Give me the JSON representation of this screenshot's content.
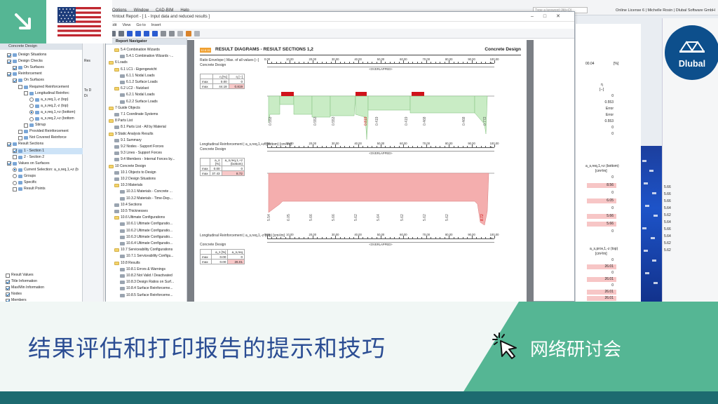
{
  "app": {
    "menu": [
      "Options",
      "Window",
      "CAD-BIM",
      "Help"
    ],
    "search_placeholder": "Type a keyword (Alt+Q)",
    "license_info": "Online License 6 | Michelle Rosin | Dlubal Software GmbH"
  },
  "left_panel": {
    "title": "Concrete Design",
    "rows": [
      {
        "label": "Design Situations",
        "checked": true
      },
      {
        "label": "Design Checks",
        "checked": true
      },
      {
        "label": "On Surfaces",
        "checked": true
      },
      {
        "label": "Reinforcement",
        "checked": true
      },
      {
        "label": "On Surfaces",
        "checked": true
      },
      {
        "label": "Required Reinforcement",
        "checked": false
      },
      {
        "label": "Longitudinal Reinforc",
        "checked": false
      },
      {
        "label": "a_s,req,1,-z (top)",
        "radio": false
      },
      {
        "label": "a_s,req,2,-z (top)",
        "radio": false
      },
      {
        "label": "a_s,req,1,+z (bottom)",
        "radio": true
      },
      {
        "label": "a_s,req,2,+z (bottom",
        "radio": false
      },
      {
        "label": "Stirrup",
        "checked": false
      },
      {
        "label": "Provided Reinforcement",
        "checked": false
      },
      {
        "label": "Not Covered Reinforce",
        "checked": false
      },
      {
        "label": "Result Sections",
        "checked": true
      },
      {
        "label": "1 - Section 1",
        "checked": true,
        "selected": true
      },
      {
        "label": "2 - Section 2",
        "checked": false
      },
      {
        "label": "Values on Surfaces",
        "checked": true
      },
      {
        "label": "Current Selection: a_s,req,1,+z (b",
        "radio": true
      },
      {
        "label": "Groups",
        "radio": false
      },
      {
        "label": "Specific",
        "radio": false
      },
      {
        "label": "Result Points",
        "checked": false
      }
    ],
    "bottom_rows": [
      {
        "label": "Result Values",
        "checked": false
      },
      {
        "label": "Title Information",
        "checked": true
      },
      {
        "label": "Max/Min Information",
        "checked": true
      },
      {
        "label": "Nodes",
        "checked": true
      },
      {
        "label": "Members",
        "checked": true
      }
    ]
  },
  "mini_tabs": [
    "Co",
    "Res",
    "To D",
    "Di"
  ],
  "report_window": {
    "title": "Printout Report - [ 1 - Input data and reduced results ]",
    "menu": [
      "Edit",
      "View",
      "Go to",
      "Insert"
    ],
    "navigator_title": "Report Navigator",
    "nav_items": [
      {
        "label": "5.4 Combination Wizards",
        "type": "folder",
        "indent": 1
      },
      {
        "label": "5.4.1 Combination Wizards -...",
        "type": "page",
        "indent": 2
      },
      {
        "label": "6 Loads",
        "type": "folder",
        "indent": 0
      },
      {
        "label": "6.1 LC1 - Eigengewicht",
        "type": "folder",
        "indent": 1
      },
      {
        "label": "6.1.1 Nodal Loads",
        "type": "page",
        "indent": 2
      },
      {
        "label": "6.1.2 Surface Loads",
        "type": "page",
        "indent": 2
      },
      {
        "label": "6.2 LC2 - Nutzlast",
        "type": "folder",
        "indent": 1
      },
      {
        "label": "6.2.1 Nodal Loads",
        "type": "page",
        "indent": 2
      },
      {
        "label": "6.2.2 Surface Loads",
        "type": "page",
        "indent": 2
      },
      {
        "label": "7 Guide Objects",
        "type": "folder",
        "indent": 0
      },
      {
        "label": "7.1 Coordinate Systems",
        "type": "page",
        "indent": 1
      },
      {
        "label": "8 Parts List",
        "type": "folder",
        "indent": 0
      },
      {
        "label": "8.1 Parts List - All by Material",
        "type": "page",
        "indent": 1
      },
      {
        "label": "9 Static Analysis Results",
        "type": "folder",
        "indent": 0
      },
      {
        "label": "9.1 Summary",
        "type": "page",
        "indent": 1
      },
      {
        "label": "9.2 Nodes - Support Forces",
        "type": "page",
        "indent": 1
      },
      {
        "label": "9.3 Lines - Support Forces",
        "type": "page",
        "indent": 1
      },
      {
        "label": "9.4 Members - Internal Forces by...",
        "type": "page",
        "indent": 1
      },
      {
        "label": "10 Concrete Design",
        "type": "folder",
        "indent": 0
      },
      {
        "label": "10.1 Objects to Design",
        "type": "page",
        "indent": 1
      },
      {
        "label": "10.2 Design Situations",
        "type": "page",
        "indent": 1
      },
      {
        "label": "10.3 Materials",
        "type": "folder",
        "indent": 1
      },
      {
        "label": "10.3.1 Materials - Concrete ...",
        "type": "page",
        "indent": 2
      },
      {
        "label": "10.3.2 Materials - Time-Dep...",
        "type": "page",
        "indent": 2
      },
      {
        "label": "10.4 Sections",
        "type": "page",
        "indent": 1
      },
      {
        "label": "10.5 Thicknesses",
        "type": "page",
        "indent": 1
      },
      {
        "label": "10.6 Ultimate Configurations",
        "type": "folder",
        "indent": 1
      },
      {
        "label": "10.6.1 Ultimate Configuratio...",
        "type": "page",
        "indent": 2
      },
      {
        "label": "10.6.2 Ultimate Configuratio...",
        "type": "page",
        "indent": 2
      },
      {
        "label": "10.6.3 Ultimate Configuratio...",
        "type": "page",
        "indent": 2
      },
      {
        "label": "10.6.4 Ultimate Configuratio...",
        "type": "page",
        "indent": 2
      },
      {
        "label": "10.7 Serviceability Configurations",
        "type": "folder",
        "indent": 1
      },
      {
        "label": "10.7.1 Serviceability Configu...",
        "type": "page",
        "indent": 2
      },
      {
        "label": "10.8 Results",
        "type": "folder",
        "indent": 1
      },
      {
        "label": "10.8.1 Errors & Warnings",
        "type": "page",
        "indent": 2
      },
      {
        "label": "10.8.2 Not Valid / Deactivated",
        "type": "page",
        "indent": 2
      },
      {
        "label": "10.8.3 Design Ratios on Surf...",
        "type": "page",
        "indent": 2
      },
      {
        "label": "10.8.4 Surface Reinforceme...",
        "type": "page",
        "indent": 2
      },
      {
        "label": "10.8.5 Surface Reinforceme...",
        "type": "page",
        "indent": 2
      }
    ]
  },
  "report_page": {
    "badge": "10.8.15",
    "title": "RESULT DIAGRAMS - RESULT SECTIONS 1,2",
    "right_title": "Concrete Design",
    "overlapped": "<OVERLAPPED>",
    "ruler_labels": [
      "0.00",
      "10.00",
      "20.00",
      "30.00",
      "40.00",
      "50.00",
      "60.00",
      "70.00",
      "80.00",
      "90.00",
      "100.00 %"
    ],
    "sections": [
      {
        "label": "Ratio Envelope | Max. of all values [--]",
        "sublabel": "Concrete Design",
        "table": {
          "header": [
            "",
            "η [%]",
            "η [--]"
          ],
          "rows": [
            [
              "max",
              "0.00",
              "0"
            ],
            [
              "max",
              "44.18",
              "0.819"
            ]
          ]
        },
        "value_labels": [
          "0.553",
          "0.553",
          "0.553",
          "0.819",
          "0.419",
          "0.419",
          "0.468",
          "0.468",
          "0.772"
        ]
      },
      {
        "label": "Longitudinal Reinforcement | a_s,req,1,+z (bottom) [cm²/m]",
        "sublabel": "Concrete Design",
        "table": {
          "header": [
            "",
            "a_s [%]",
            "a_s,req,1,+z (bottom)"
          ],
          "rows": [
            [
              "max",
              "0.00",
              "0"
            ],
            [
              "max",
              "37.43",
              "8.72"
            ]
          ]
        },
        "value_labels": [
          "5.54",
          "6.05",
          "5.66",
          "5.66",
          "5.62",
          "5.64",
          "5.62",
          "5.62",
          "5.62",
          "8.72"
        ]
      },
      {
        "label": "Longitudinal Reinforcement | a_s,req,1,-z (top) [cm²/m]",
        "sublabel": "Concrete Design",
        "table": {
          "header": [
            "",
            "a_s [%]",
            "a_s,req"
          ],
          "rows": [
            [
              "max",
              "0.00",
              "0"
            ],
            [
              "max",
              "0.00",
              "26.01"
            ]
          ]
        },
        "value_labels": []
      }
    ]
  },
  "right_window": {
    "zoom": "00.04",
    "unit": "[%]",
    "col1_header": "η",
    "col1_sub": "[--]",
    "col1_values": [
      "0",
      "0.553",
      "Error",
      "Error",
      "0.553",
      "0",
      "0"
    ],
    "col2_header": "a_s,req,1,+z (bottom)",
    "col2_sub": "[cm²/m]",
    "col2_values": [
      "0",
      "8.56",
      "0",
      "6.05",
      "0",
      "5.66",
      "5.66",
      "0"
    ],
    "col3_header": "a_s,prov,1,-z (top)",
    "col3_sub": "[cm²/m]",
    "col3_values": [
      "0",
      "26.01",
      "0",
      "26.01",
      "0",
      "26.01",
      "26.01",
      "26.01"
    ],
    "blue_values": [
      "5.66",
      "5.66",
      "5.66",
      "5.64",
      "5.62",
      "5.64",
      "5.66",
      "5.64",
      "5.62",
      "5.62"
    ]
  },
  "banner": {
    "title": "结果评估和打印报告的提示和技巧",
    "subtitle": "网络研讨会",
    "logo": "Dlubal"
  },
  "colors": {
    "accent_teal": "#5ab89a",
    "title_blue": "#2b4d93",
    "logo_blue": "#0d4f8c",
    "bar_green": "#c9ecc5",
    "bar_red": "#f4aeae",
    "flag_red": "#c0262f",
    "flag_blue": "#1c3b7a"
  },
  "icons": {
    "corner": "arrow-down-right-icon",
    "flag": "us-flag-icon",
    "click": "cursor-click-icon"
  }
}
